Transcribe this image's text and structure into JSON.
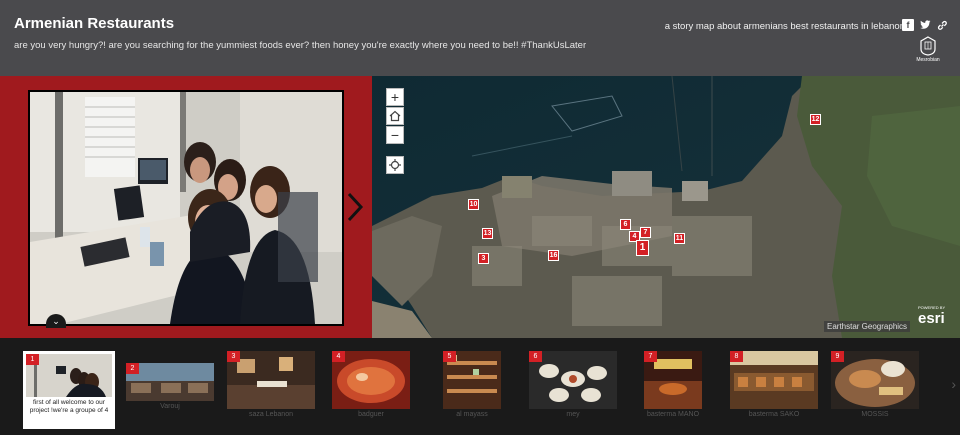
{
  "header": {
    "title": "Armenian Restaurants",
    "subtitle": "are you very hungry?! are you searching for the yummiest foods ever? then honey you're exactly where you need to be!! #ThankUsLater",
    "tagline": "a story map about armenians best restaurants in lebanon",
    "logo_text": "Mesrobian",
    "social_icons": [
      "facebook-icon",
      "twitter-icon",
      "link-icon"
    ]
  },
  "media": {
    "expand_icon": "chevron-down-icon",
    "next_icon": "chevron-right-icon"
  },
  "map": {
    "controls": [
      "+",
      "⌂",
      "−",
      "⌖"
    ],
    "attribution": "Earthstar Geographics",
    "powered_by": "POWERED BY",
    "brand": "esri",
    "pins": [
      "12",
      "10",
      "13",
      "3",
      "16",
      "6",
      "4",
      "7",
      "1",
      "11"
    ]
  },
  "carousel": {
    "items": [
      {
        "num": "1",
        "caption": "first of all welcome to our project !we're a groupe of 4"
      },
      {
        "num": "2",
        "caption": "Varouj"
      },
      {
        "num": "3",
        "caption": "saza Lebanon"
      },
      {
        "num": "4",
        "caption": "badguer"
      },
      {
        "num": "5",
        "caption": "al mayass"
      },
      {
        "num": "6",
        "caption": "mey"
      },
      {
        "num": "7",
        "caption": "basterma MANO"
      },
      {
        "num": "8",
        "caption": "basterma SAKO"
      },
      {
        "num": "9",
        "caption": "MOSSIS"
      }
    ]
  },
  "colors": {
    "header_bg": "#4a4a4d",
    "media_bg": "#a01a1e",
    "pin": "#d32025"
  }
}
